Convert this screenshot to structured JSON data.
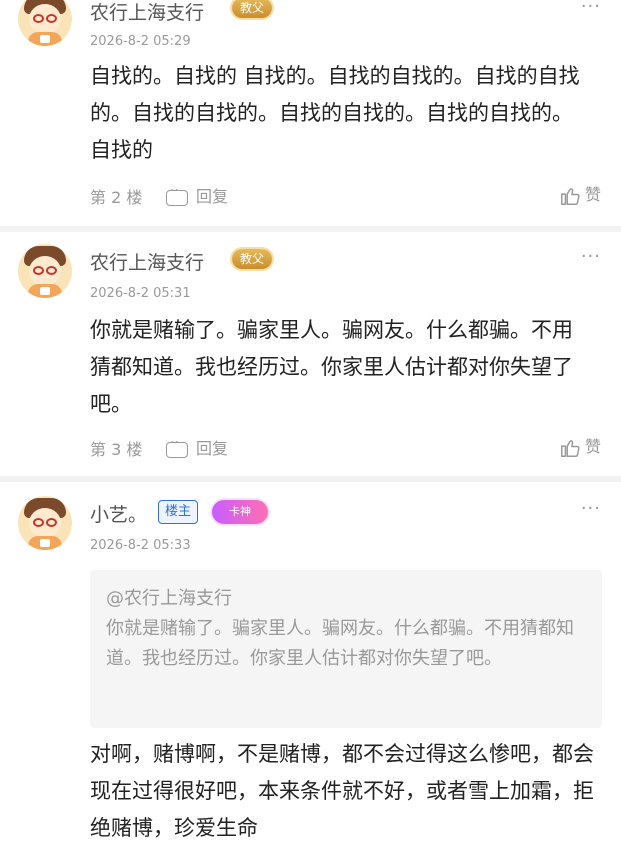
{
  "posts": [
    {
      "username": "农行上海支行",
      "badge": "教父",
      "timestamp": "2026-8-2 05:29",
      "content": "自找的。自找的 自找的。自找的自找的。自找的自找的。自找的自找的。自找的自找的。自找的自找的。自找的",
      "floor": "第 2 楼",
      "reply_label": "回复",
      "like_label": "赞",
      "more": "···"
    },
    {
      "username": "农行上海支行",
      "badge": "教父",
      "timestamp": "2026-8-2 05:31",
      "content": "你就是赌输了。骗家里人。骗网友。什么都骗。不用猜都知道。我也经历过。你家里人估计都对你失望了吧。",
      "floor": "第 3 楼",
      "reply_label": "回复",
      "like_label": "赞",
      "more": "···"
    },
    {
      "username": "小艺。",
      "owner_tag": "楼主",
      "badge": "卡神",
      "timestamp": "2026-8-2 05:33",
      "quote": {
        "author": "@农行上海支行",
        "text": "你就是赌输了。骗家里人。骗网友。什么都骗。不用猜都知道。我也经历过。你家里人估计都对你失望了吧。"
      },
      "content": "对啊，赌博啊，不是赌博，都不会过得这么惨吧，都会现在过得很好吧，本来条件就不好，或者雪上加霜，拒绝赌博，珍爱生命",
      "more": "···"
    }
  ],
  "colors": {
    "accent_blue": "#2f72d6",
    "muted_text": "#999999",
    "body_text": "#222222",
    "badge_gold": "#c98e2b",
    "divider": "#f2f2f2"
  },
  "icons": [
    "avatar",
    "reply-icon",
    "like-icon",
    "more-icon"
  ]
}
